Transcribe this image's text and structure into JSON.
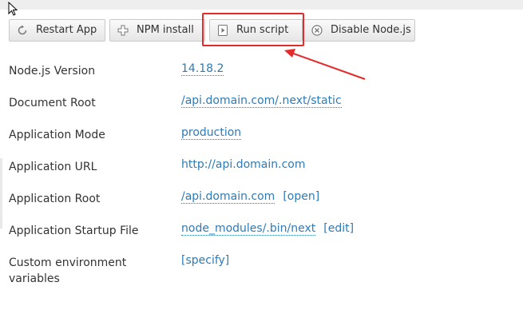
{
  "toolbar": {
    "restart_label": "Restart App",
    "npm_label": "NPM install",
    "run_label": "Run script",
    "disable_label": "Disable Node.js"
  },
  "properties": [
    {
      "label": "Node.js Version",
      "value": "14.18.2"
    },
    {
      "label": "Document Root",
      "value": "/api.domain.com/.next/static"
    },
    {
      "label": "Application Mode",
      "value": "production"
    },
    {
      "label": "Application URL",
      "value": "http://api.domain.com"
    },
    {
      "label": "Application Root",
      "value": "/api.domain.com",
      "extra": "[open]"
    },
    {
      "label": "Application Startup File",
      "value": "node_modules/.bin/next",
      "extra": "[edit]"
    },
    {
      "label": "Custom environment variables",
      "value": "[specify]"
    }
  ],
  "colors": {
    "link": "#2e7bb5",
    "highlight": "#e32b2b"
  },
  "icons": [
    "mouse-cursor-icon",
    "restart-icon",
    "plus-icon",
    "run-script-icon",
    "disable-icon",
    "arrow-annotation"
  ]
}
